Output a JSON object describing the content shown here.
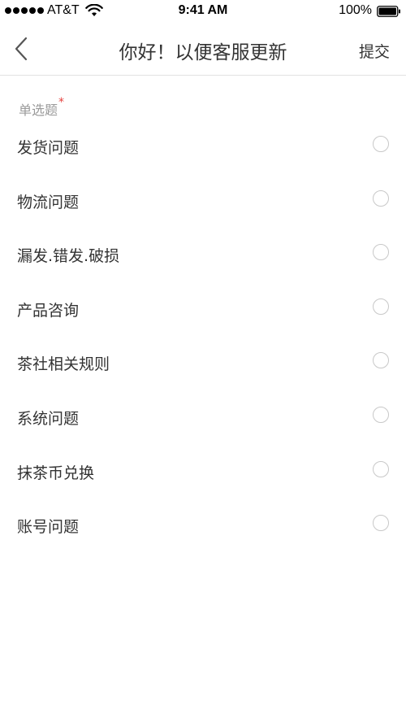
{
  "status_bar": {
    "carrier": "AT&T",
    "time": "9:41 AM",
    "battery": "100%"
  },
  "nav": {
    "title": "你好！以便客服更新",
    "submit_label": "提交",
    "back_icon": "chevron-left-icon"
  },
  "form": {
    "section_label": "单选题",
    "required_mark": "*",
    "options": [
      {
        "label": "发货问题",
        "selected": false
      },
      {
        "label": "物流问题",
        "selected": false
      },
      {
        "label": "漏发.错发.破损",
        "selected": false
      },
      {
        "label": "产品咨询",
        "selected": false
      },
      {
        "label": "茶社相关规则",
        "selected": false
      },
      {
        "label": "系统问题",
        "selected": false
      },
      {
        "label": "抹茶币兑换",
        "selected": false
      },
      {
        "label": "账号问题",
        "selected": false
      }
    ]
  },
  "colors": {
    "required": "#e64340",
    "divider": "#e2e2e2",
    "radio_border": "#c8c8c8"
  }
}
